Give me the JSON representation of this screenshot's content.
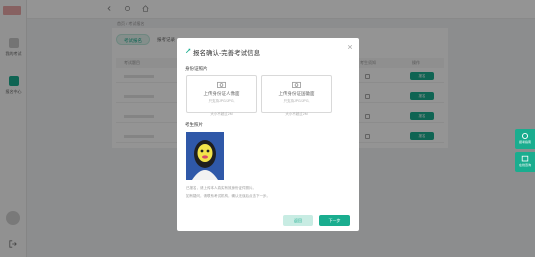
{
  "sidebar": {
    "items": [
      {
        "label": "我的考试"
      },
      {
        "label": "报名中心"
      }
    ]
  },
  "breadcrumb": "首页 / 考试报名",
  "panel": {
    "tabs": [
      {
        "label": "考试报名"
      },
      {
        "label": "报考记录"
      }
    ],
    "columns": [
      "考试题目",
      "考生须知",
      "操作"
    ],
    "rows": [
      {
        "action": "报名"
      },
      {
        "action": "报名"
      },
      {
        "action": "报名"
      },
      {
        "action": "报名"
      }
    ]
  },
  "float_buttons": [
    {
      "label": "报考指南",
      "icon": "refresh-icon"
    },
    {
      "label": "在线咨询",
      "icon": "chat-icon"
    }
  ],
  "modal": {
    "title": "报名确认-完善考试信息",
    "id_photo_label": "身份证照片",
    "upload_front": {
      "title": "上传身份证人像面",
      "hint1": "只支持JPG/JPG,",
      "hint2": "大小不超过2M"
    },
    "upload_back": {
      "title": "上传身份证国徽面",
      "hint1": "只支持JPG/JPG,",
      "hint2": "大小不超过2M"
    },
    "photo_label": "考生照片",
    "note1": "已报名，请上传本人真实有效身份证件照片。",
    "note2": "如有疑问，请联系考试机构，确认无误后点击下一步。",
    "prev_label": "返回",
    "next_label": "下一步"
  },
  "colors": {
    "accent": "#1aad8f"
  }
}
